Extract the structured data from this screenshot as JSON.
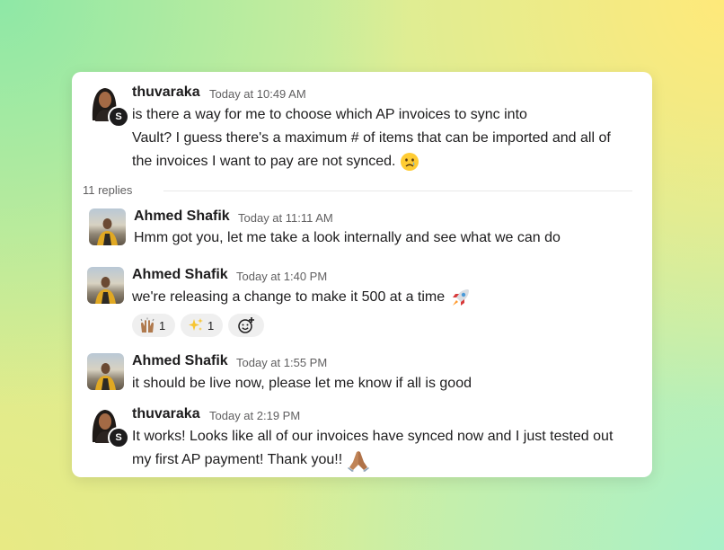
{
  "thread": {
    "parent": {
      "author": "thuvaraka",
      "time": "Today at 10:49 AM",
      "badge": "S",
      "lines": [
        "is there a way for me to choose which AP invoices to sync into",
        "Vault? I guess there's a maximum # of items that can be imported and all of",
        "the invoices I want to pay are not synced."
      ],
      "emoji": "crying-face"
    },
    "replies_label": "11 replies",
    "replies": [
      {
        "author": "Ahmed Shafik",
        "time": "Today at 11:11 AM",
        "text": "Hmm got you, let me take a look internally and see what we can do"
      },
      {
        "author": "Ahmed Shafik",
        "time": "Today at 1:40 PM",
        "text": "we're releasing a change to make it 500 at a time",
        "emoji": "rocket",
        "reactions": [
          {
            "emoji": "raised-hands",
            "count": "1"
          },
          {
            "emoji": "sparkles",
            "count": "1"
          }
        ],
        "add_reaction_icon": "add-reaction-icon"
      },
      {
        "author": "Ahmed Shafik",
        "time": "Today at 1:55 PM",
        "text": "it should be live now, please let me know if all is good"
      },
      {
        "author": "thuvaraka",
        "time": "Today at 2:19 PM",
        "badge": "S",
        "lines": [
          "It works! Looks like all of our invoices have synced now and I just tested out",
          "my first AP payment! Thank you!!"
        ],
        "emoji": "folded-hands"
      }
    ]
  },
  "colors": {
    "card_bg": "#ffffff",
    "text": "#1d1c1d",
    "muted": "#616061",
    "reaction_bg": "#efefef"
  }
}
